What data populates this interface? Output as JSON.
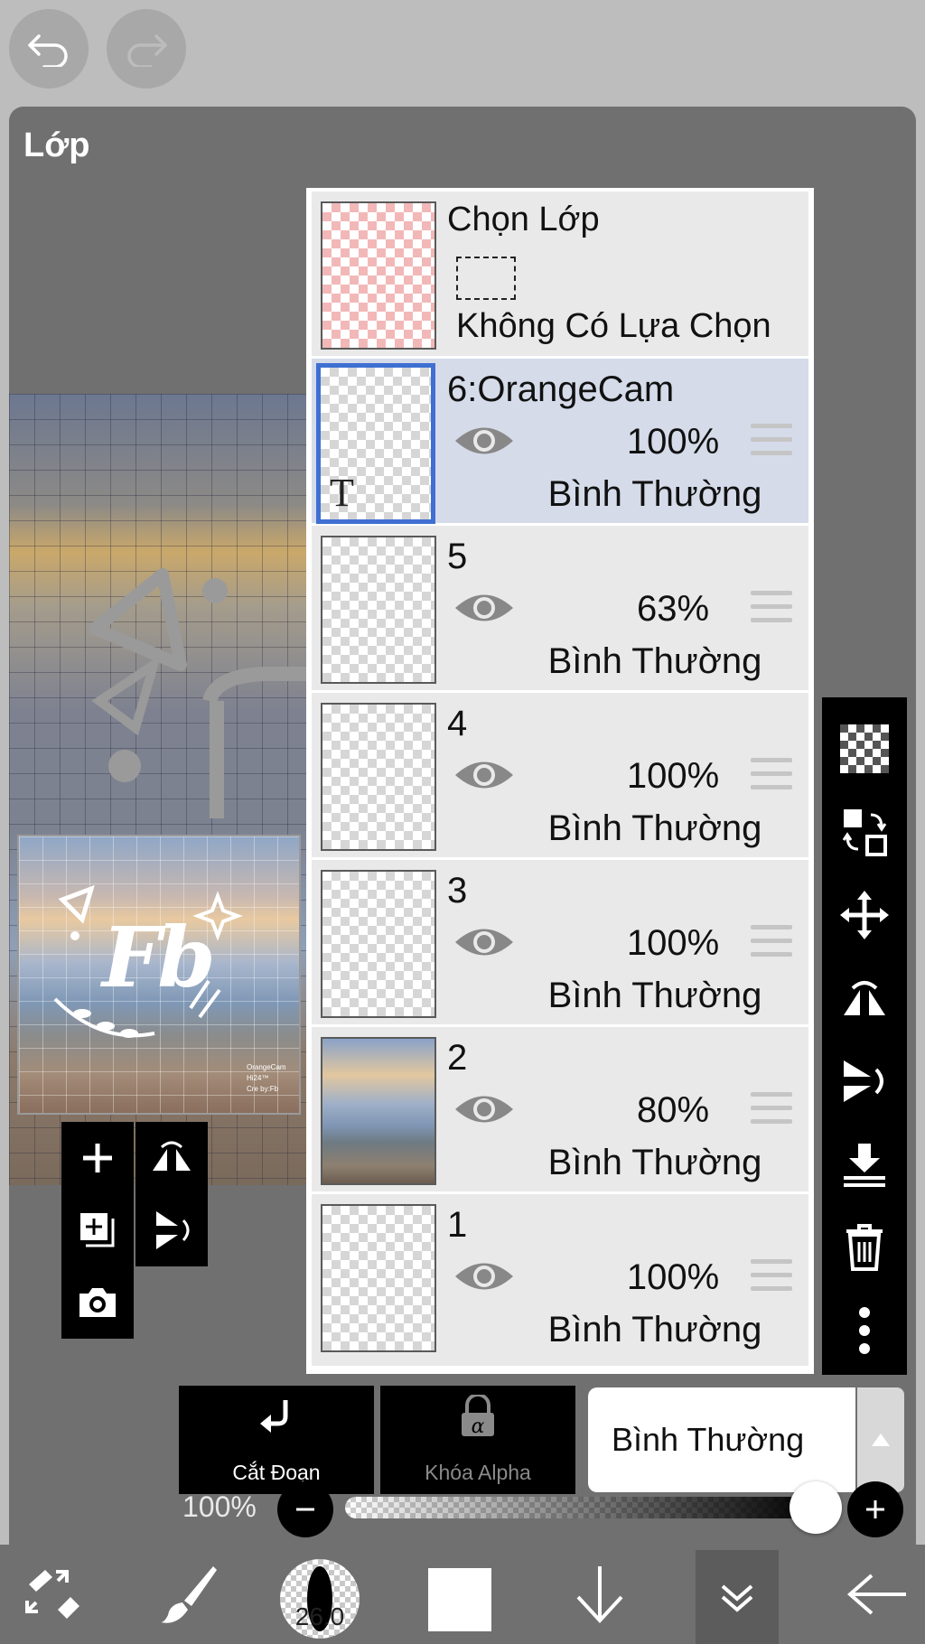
{
  "panel": {
    "title": "Lớp"
  },
  "icons": {
    "undo": "undo-icon",
    "redo": "redo-icon"
  },
  "selection_layer": {
    "title": "Chọn Lớp",
    "status": "Không Có Lựa Chọn"
  },
  "layers": [
    {
      "name": "6:OrangeCam",
      "opacity": "100%",
      "mode": "Bình Thường",
      "selected": true,
      "type": "text"
    },
    {
      "name": "5",
      "opacity": "63%",
      "mode": "Bình Thường",
      "selected": false
    },
    {
      "name": "4",
      "opacity": "100%",
      "mode": "Bình Thường",
      "selected": false
    },
    {
      "name": "3",
      "opacity": "100%",
      "mode": "Bình Thường",
      "selected": false
    },
    {
      "name": "2",
      "opacity": "80%",
      "mode": "Bình Thường",
      "selected": false
    },
    {
      "name": "1",
      "opacity": "100%",
      "mode": "Bình Thường",
      "selected": false
    }
  ],
  "preview": {
    "logo_text": "Fb",
    "caption_lines": [
      "OrangeCam",
      "Hi24™",
      "Cre by:Fb"
    ]
  },
  "actions": {
    "clipping": "Cắt Đoạn",
    "alpha_lock": "Khóa Alpha",
    "blend_mode": "Bình Thường"
  },
  "opacity_slider": {
    "label": "100%",
    "value": 1.0
  },
  "bottom_nav": {
    "brush_size": "26.0"
  },
  "colors": {
    "accent": "#3f6fd2",
    "selected_row": "#d5dbe9",
    "panel": "#707070"
  }
}
